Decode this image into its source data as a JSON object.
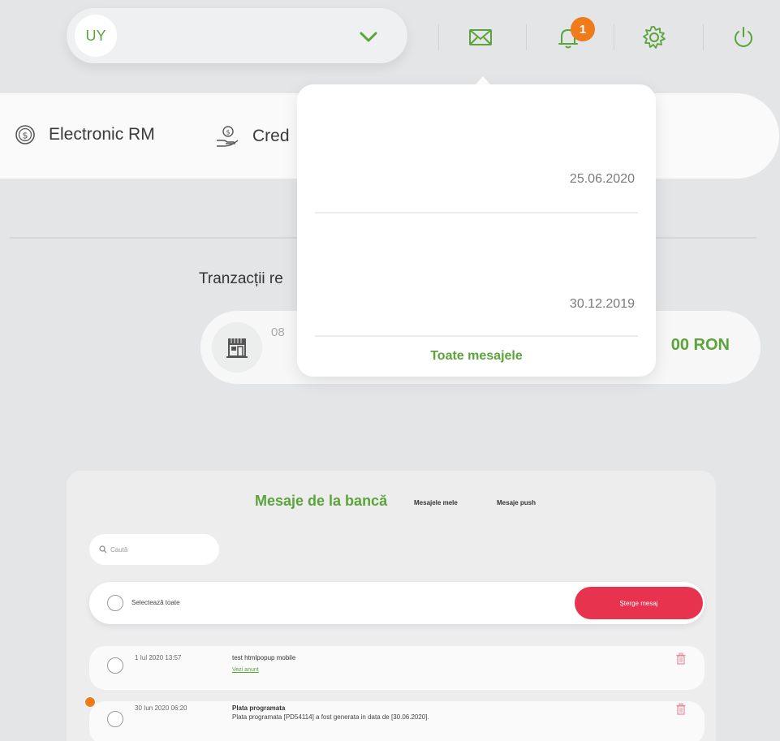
{
  "header": {
    "user_initials": "UY",
    "notification_count": "1",
    "accent_color": "#5aa43a",
    "badge_color": "#f07b1a"
  },
  "products": [
    {
      "label": "Electronic RM",
      "icon": "dollar-coin-icon"
    },
    {
      "label": "Cred",
      "icon": "hand-coin-icon"
    }
  ],
  "transactions": {
    "title": "Tranzacții re",
    "card": {
      "date": "08",
      "amount": "00 RON",
      "icon": "store-icon"
    }
  },
  "dropdown": {
    "messages": [
      {
        "date": "25.06.2020"
      },
      {
        "date": "30.12.2019"
      }
    ],
    "all_messages_label": "Toate mesajele"
  },
  "messages_panel": {
    "title": "Mesaje de la bancă",
    "tabs": [
      "Mesajele mele",
      "Mesaje push"
    ],
    "search_placeholder": "Caută",
    "select_all_label": "Selectează toate",
    "delete_label": "Șterge mesaj",
    "delete_color": "#e8334e",
    "rows": [
      {
        "date": "1 Iul 2020 13:57",
        "subject": "test htmlpopup mobile",
        "link": "Vezi anunț",
        "unread": false
      },
      {
        "date": "30 Iun 2020 06:20",
        "subject": "Plata programata",
        "body": "Plata programata [PD54114] a fost generata in data de [30.06.2020].",
        "unread": true
      }
    ]
  }
}
